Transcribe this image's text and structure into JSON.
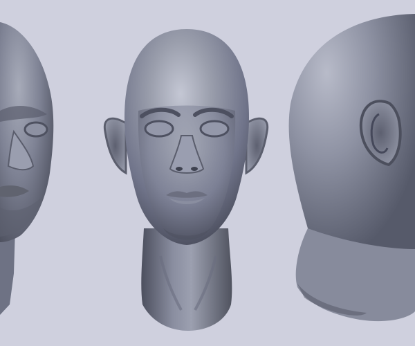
{
  "scene": {
    "background": "#cfd0de",
    "material": {
      "base": "#7b7f8e",
      "highlight": "#c9ccd8",
      "shadow": "#3d404c"
    },
    "views": [
      {
        "name": "three-quarter",
        "visible": "partial"
      },
      {
        "name": "front",
        "visible": "full"
      },
      {
        "name": "back-right-profile",
        "visible": "partial"
      }
    ]
  }
}
